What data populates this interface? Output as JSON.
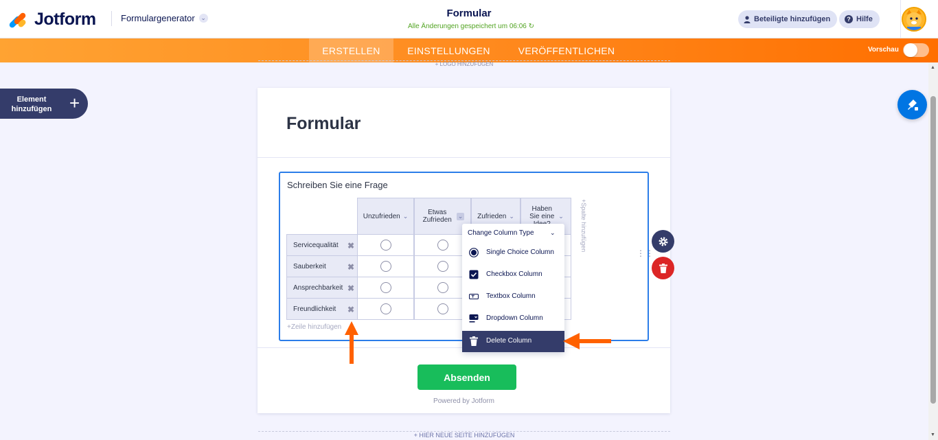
{
  "header": {
    "logo_text": "Jotform",
    "product_menu": "Formulargenerator",
    "form_title": "Formular",
    "save_status": "Alle Änderungen gespeichert um 06:06",
    "invite_button": "Beteiligte hinzufügen",
    "help_button": "Hilfe"
  },
  "tabs": {
    "items": [
      {
        "label": "ERSTELLEN",
        "active": true
      },
      {
        "label": "EINSTELLUNGEN",
        "active": false
      },
      {
        "label": "VERÖFFENTLICHEN",
        "active": false
      }
    ],
    "preview_label": "Vorschau",
    "preview_on": false
  },
  "canvas": {
    "add_logo": "+ LOGO HINZUFÜGEN",
    "add_element_label": "Element hinzufügen",
    "add_new_page": "+ HIER NEUE SEITE HINZUFÜGEN"
  },
  "form": {
    "title": "Formular",
    "question": "Schreiben Sie eine Frage",
    "columns": [
      "Unzufrieden",
      "Etwas Zufrieden",
      "Zufrieden",
      "Haben Sie eine Idee?"
    ],
    "rows": [
      "Servicequalität",
      "Sauberkeit",
      "Ansprechbarkeit",
      "Freundlichkeit"
    ],
    "add_row": "+Zeile hinzufügen",
    "add_column": "+Spalte hinzufügen",
    "submit_label": "Absenden",
    "powered_by": "Powered by Jotform"
  },
  "column_menu": {
    "header": "Change Column Type",
    "items": [
      {
        "label": "Single Choice Column",
        "icon": "radio-icon"
      },
      {
        "label": "Checkbox Column",
        "icon": "checkbox-icon"
      },
      {
        "label": "Textbox Column",
        "icon": "textbox-icon"
      },
      {
        "label": "Dropdown Column",
        "icon": "dropdown-icon"
      },
      {
        "label": "Delete Column",
        "icon": "trash-icon",
        "highlighted": true
      }
    ]
  },
  "colors": {
    "brand_orange": "#ff6f00",
    "accent_blue": "#2b7de9",
    "submit_green": "#18bd5b",
    "navy": "#343c6a",
    "danger_red": "#dc2626"
  }
}
